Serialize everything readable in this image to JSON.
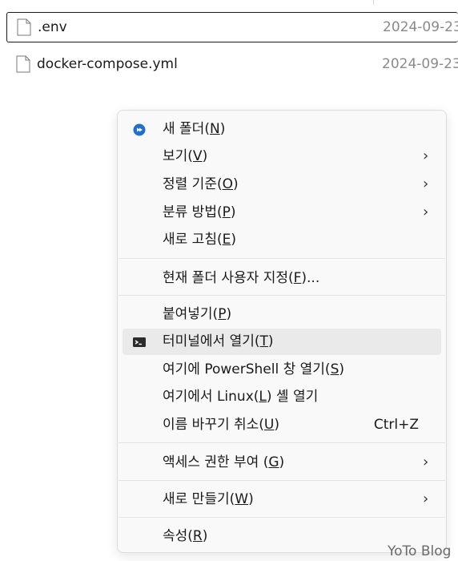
{
  "files": [
    {
      "name": ".env",
      "date": "2024-09-23"
    },
    {
      "name": "docker-compose.yml",
      "date": "2024-09-23"
    }
  ],
  "context_menu": {
    "items": [
      {
        "label_pre": "새 폴더(",
        "key": "N",
        "label_post": ")",
        "icon": "new-folder-icon"
      },
      {
        "label_pre": "보기(",
        "key": "V",
        "label_post": ")",
        "submenu": "›"
      },
      {
        "label_pre": "정렬 기준(",
        "key": "O",
        "label_post": ")",
        "submenu": "›"
      },
      {
        "label_pre": "분류 방법(",
        "key": "P",
        "label_post": ")",
        "submenu": "›"
      },
      {
        "label_pre": "새로 고침(",
        "key": "E",
        "label_post": ")"
      },
      {
        "label_pre": "현재 폴더 사용자 지정(",
        "key": "F",
        "label_post": ")..."
      },
      {
        "label_pre": "붙여넣기(",
        "key": "P",
        "label_post": ")"
      },
      {
        "label_pre": "터미널에서 열기(",
        "key": "T",
        "label_post": ")",
        "icon": "terminal-icon"
      },
      {
        "label_pre": "여기에 PowerShell 창 열기(",
        "key": "S",
        "label_post": ")"
      },
      {
        "label_pre": "여기에서 Linux(",
        "key": "L",
        "label_post": ") 셸 열기"
      },
      {
        "label_pre": "이름 바꾸기 취소(",
        "key": "U",
        "label_post": ")",
        "shortcut": "Ctrl+Z"
      },
      {
        "label_pre": "액세스 권한 부여 (",
        "key": "G",
        "label_post": ")",
        "submenu": "›"
      },
      {
        "label_pre": "새로 만들기(",
        "key": "W",
        "label_post": ")",
        "submenu": "›"
      },
      {
        "label_pre": "속성(",
        "key": "R",
        "label_post": ")"
      }
    ]
  },
  "watermark": "YoTo Blog",
  "colors": {
    "menu_bg": "#f9f9f9",
    "hover_bg": "#eaeaea",
    "accent_blue": "#1f6fd1"
  }
}
